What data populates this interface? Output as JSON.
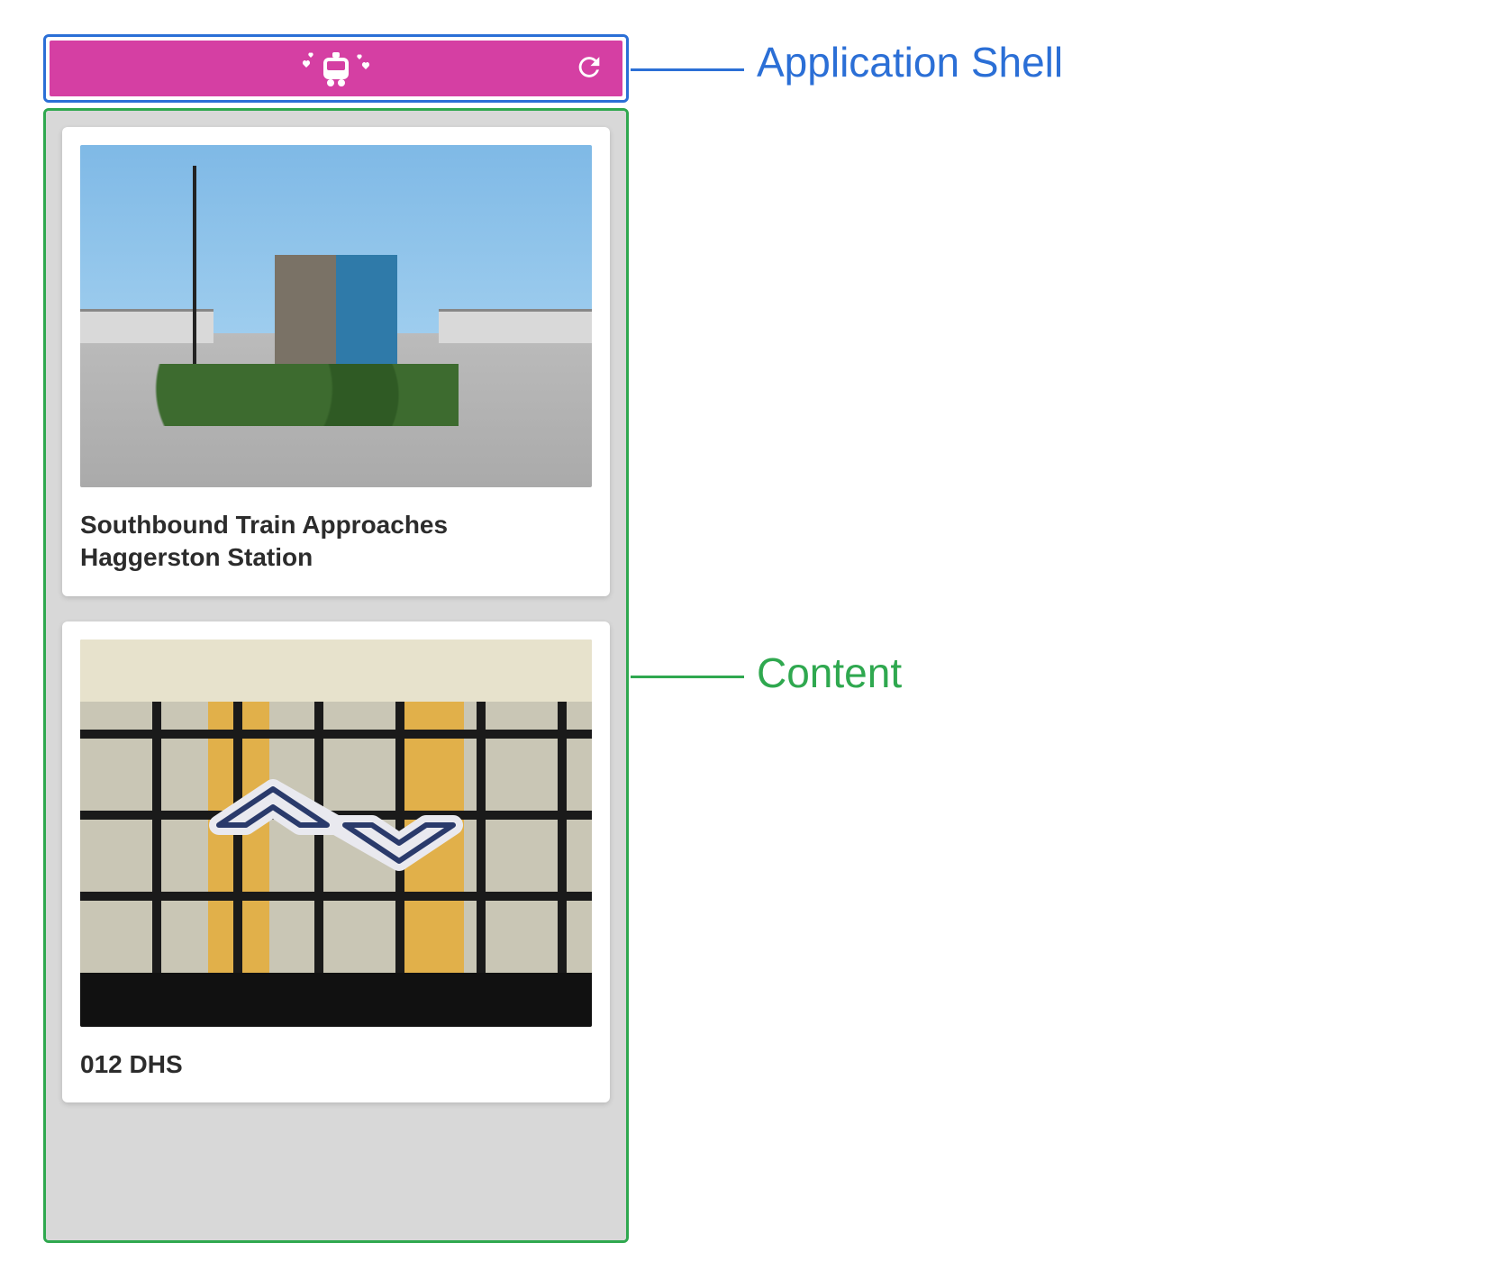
{
  "annotations": {
    "shell_label": "Application Shell",
    "content_label": "Content",
    "shell_color": "#2b6fd6",
    "content_color": "#2fa84f"
  },
  "shell": {
    "logo_semantic": "train-with-hearts-icon",
    "refresh_semantic": "refresh-icon",
    "bar_color": "#d53fa3"
  },
  "content": {
    "cards": [
      {
        "title": "Southbound Train Approaches Haggerston Station"
      },
      {
        "title": "012 DHS"
      }
    ]
  }
}
